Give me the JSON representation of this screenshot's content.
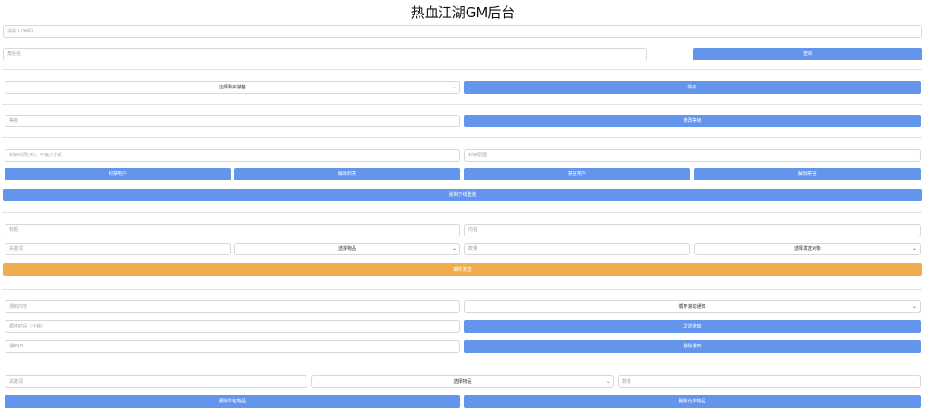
{
  "page": {
    "title": "热血江湖GM后台"
  },
  "query": {
    "gm_placeholder": "请输入GM码",
    "role_placeholder": "角色名",
    "query_button": "查询"
  },
  "purchase": {
    "equipment_select": "选择购买装备",
    "buy_button": "购买"
  },
  "level": {
    "level_placeholder": "等级",
    "modify_button": "修改等级"
  },
  "ban": {
    "duration_placeholder": "封禁时间(天)，可输入小数",
    "reason_placeholder": "封禁原因",
    "ban_user": "封禁用户",
    "unban": "解除封禁",
    "mute_user": "禁言用户",
    "unmute": "解除禁言",
    "force_offline": "强制下线重连"
  },
  "mail": {
    "title_placeholder": "标题",
    "content_placeholder": "内容",
    "keyword_placeholder": "关键词",
    "item_select": "选择物品",
    "quantity_placeholder": "数量",
    "target_select": "选择发送对象",
    "send_button": "邮件发送"
  },
  "notice": {
    "content_placeholder": "通知内容",
    "type_select": "循环滚动通知",
    "interval_placeholder": "循环时间（分钟）",
    "send_button": "发送通知",
    "id_placeholder": "通知ID",
    "delete_button": "删除通知"
  },
  "items": {
    "keyword_placeholder": "关键词",
    "item_select": "选择物品",
    "quantity_placeholder": "数量",
    "delete_bag_button": "删除背包物品",
    "delete_warehouse_button": "删除仓库物品"
  },
  "colors": {
    "primary": "#6495ed",
    "warning": "#f0ad4e"
  },
  "icons": {
    "select_chevron": "chevron-down-icon"
  }
}
